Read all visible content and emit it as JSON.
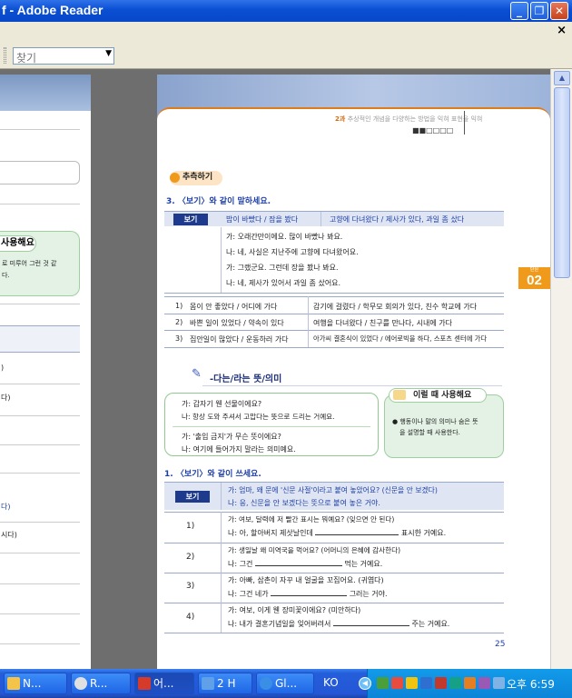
{
  "window": {
    "title": "f - Adobe Reader",
    "minimize_icon": "minimize-icon",
    "maximize_icon": "restore-icon",
    "close_icon": "close-icon",
    "doc_close": "×"
  },
  "toolbar": {
    "search_placeholder": "찾기",
    "dropdown_glyph": "▼"
  },
  "left_page": {
    "green_tag": "사용해요",
    "green_line1": "로 미루어 그런 것 같",
    "green_line2": "다.",
    "rows": [
      ")",
      "다)",
      "다)",
      "시다)"
    ]
  },
  "page": {
    "chapter": "2과",
    "chapter_sub": "추상적인 개념을 다양하는 방법을 익혀 표현을 익혀",
    "dots": "■■□□□□",
    "tab_label": "단원",
    "tab_number": "02",
    "section1_pill": "추측하기",
    "q3_title": "3. 〈보기〉와 같이 말하세요.",
    "bogi": "보기",
    "ex_head1": "밥이 바빴다 / 잠을 봤다",
    "ex_head2": "고향에 다녀왔다 / 제사가 있다, 과일 좀 샀다",
    "ex_lines": [
      "가: 오래간만이에요. 많이 바빴나 봐요.",
      "나: 네, 사실은 지난주에 고향에 다녀왔어요.",
      "가: 그랬군요. 그런데 장을 봤나 봐요.",
      "나: 네, 제사가 있어서 과일 좀 샀어요."
    ],
    "q3_rows": [
      {
        "n": "1)",
        "a": "몸이 안 좋았다 / 어디에 가다",
        "b": "감기에 걸렸다 / 학무모 회의가 있다, 친수 학교에 가다"
      },
      {
        "n": "2)",
        "a": "바쁜 일이 있었다 / 약속이 있다",
        "b": "여행을 다녀왔다 / 친구를 만나다, 시내에 가다"
      },
      {
        "n": "3)",
        "a": "집안일이 많았다 / 운동하러 가다",
        "b": "아가씨 결혼식이 있었다 / 에어로빅을 하다, 스포츠 센터에 가다"
      }
    ],
    "grammar_title": "-다는/라는 뜻/의미",
    "dialog1": [
      "가: 갑자기 웬 선물이에요?",
      "나: 항상 도와 주셔서 고맙다는 뜻으로 드리는 거예요."
    ],
    "dialog2": [
      "가: '출입 금지'가 무슨 뜻이에요?",
      "나: 여기에 들어가지 말라는 의미예요."
    ],
    "use_title": "이럴 때 사용해요",
    "use_lines": [
      "● 행동이나 말의 의미나 숨은 뜻",
      "을 설명할 때 사용한다."
    ],
    "q1_title": "1. 〈보기〉와 같이 쓰세요.",
    "q1_ex": [
      "가: 엄마, 왜 문에 '신문 사절'이라고 붙여 놓았어요? (신문을 안 보겠다)",
      "나: 응, 신문을 안 보겠다는 뜻으로 붙여 놓은 거야."
    ],
    "q1_rows": [
      {
        "n": "1)",
        "l1": "가: 여보, 달력에 저 빨간 표시는 뭐예요? (잊으면 안 된다)",
        "l2a": "나: 아, 할아버지 제삿날인데",
        "l2b": "표시한 거예요."
      },
      {
        "n": "2)",
        "l1": "가: 생일날 왜 미역국을 먹어요? (어머니의 은혜에 감사한다)",
        "l2a": "나: 그건",
        "l2b": "먹는 거예요."
      },
      {
        "n": "3)",
        "l1": "가: 아빠, 삼촌이 자꾸 내 얼굴을 꼬집어요. (귀엽다)",
        "l2a": "나: 그건 네가",
        "l2b": "그러는 거야."
      },
      {
        "n": "4)",
        "l1": "가: 여보, 이게 웬 장미꽃이에요? (미안하다)",
        "l2a": "나: 내가 결혼기념일을 잊어버려서",
        "l2b": "주는 거예요."
      }
    ],
    "page_number": "25"
  },
  "taskbar": {
    "tasks": [
      {
        "label": "N...",
        "icon": "explorer-icon",
        "color": "#f3c34a"
      },
      {
        "label": "R...",
        "icon": "media-player-icon",
        "color": "#e0e0e0"
      },
      {
        "label": "어...",
        "icon": "adobe-reader-icon",
        "color": "#d63a2a"
      },
      {
        "label": "2 H",
        "icon": "hwp-icon",
        "color": "#5fa0e8"
      },
      {
        "label": "Gl...",
        "icon": "ie-icon",
        "color": "#3a8ee6"
      }
    ],
    "lang": "KO",
    "clock": "오후 6:59"
  },
  "colors": {
    "accent_orange": "#f09a1c",
    "text_blue": "#1d3fa8",
    "bogi_navy": "#1d3a8c",
    "green_box": "#e3f2e4",
    "xp_blue": "#245edb"
  }
}
